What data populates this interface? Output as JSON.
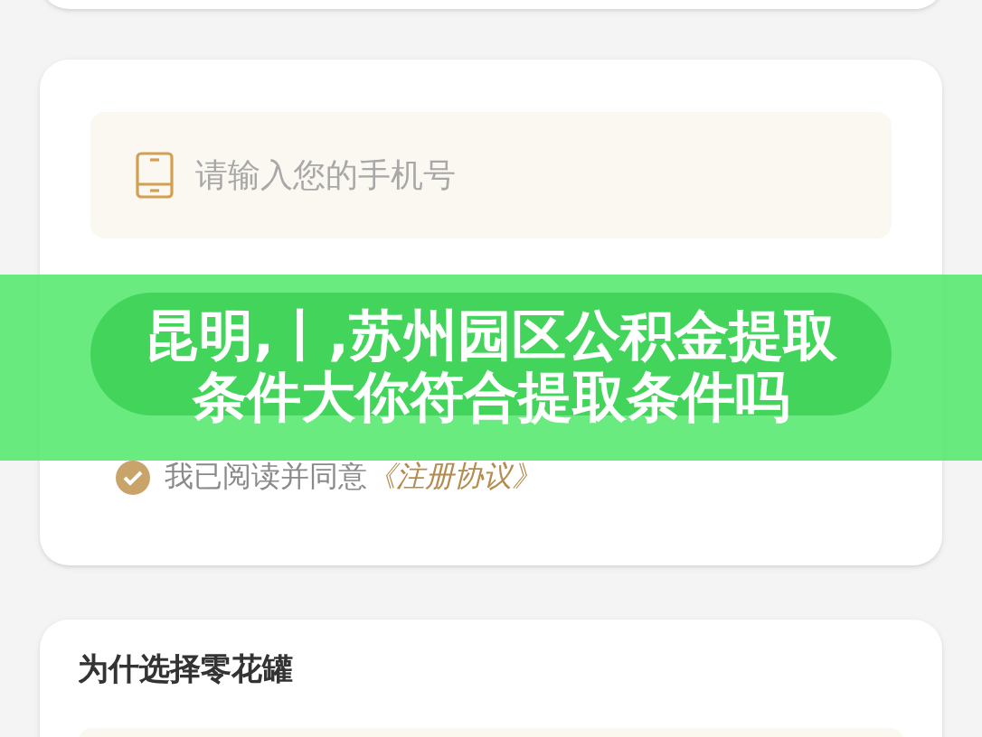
{
  "login_card": {
    "phone_field": {
      "placeholder": "请输入您的手机号"
    },
    "agreement": {
      "checked": true,
      "text": "我已阅读并同意",
      "link": "《注册协议》"
    }
  },
  "overlay_title": {
    "lines": [
      "昆明,丨,苏州园区公积金提取",
      "条件大你符合提取条件吗"
    ]
  },
  "features_card": {
    "title": "为什选择零花罐"
  }
}
